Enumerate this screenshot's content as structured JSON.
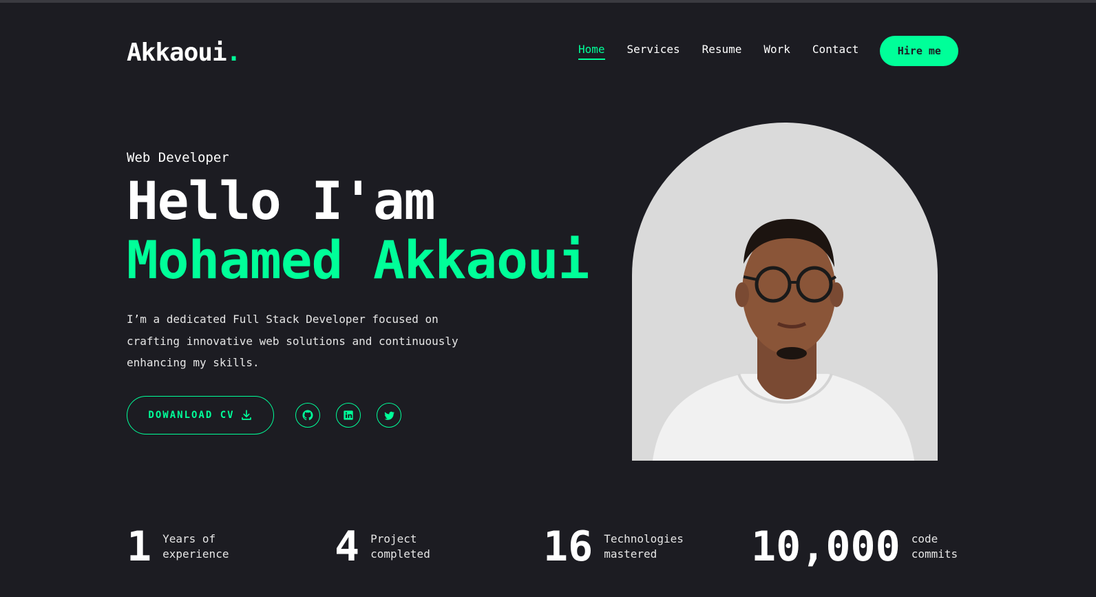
{
  "header": {
    "logo_text": "Akkaoui",
    "logo_dot": ".",
    "nav": [
      {
        "label": "Home",
        "active": true
      },
      {
        "label": "Services",
        "active": false
      },
      {
        "label": "Resume",
        "active": false
      },
      {
        "label": "Work",
        "active": false
      },
      {
        "label": "Contact",
        "active": false
      }
    ],
    "hire_label": "Hire me"
  },
  "hero": {
    "role": "Web Developer",
    "greeting": "Hello I'am",
    "name": "Mohamed Akkaoui",
    "bio": "I’m a dedicated Full Stack Developer focused on crafting innovative web solutions and continuously enhancing my skills.",
    "cv_label": "DOWANLOAD CV",
    "socials": [
      "github-icon",
      "linkedin-icon",
      "twitter-icon"
    ]
  },
  "stats": [
    {
      "number": "1",
      "label": "Years of\nexperience"
    },
    {
      "number": "4",
      "label": "Project\ncompleted"
    },
    {
      "number": "16",
      "label": "Technologies\nmastered"
    },
    {
      "number": "10,000",
      "label": "code\ncommits"
    }
  ],
  "colors": {
    "background": "#1c1c22",
    "accent": "#00ff99",
    "text": "#ffffff"
  }
}
